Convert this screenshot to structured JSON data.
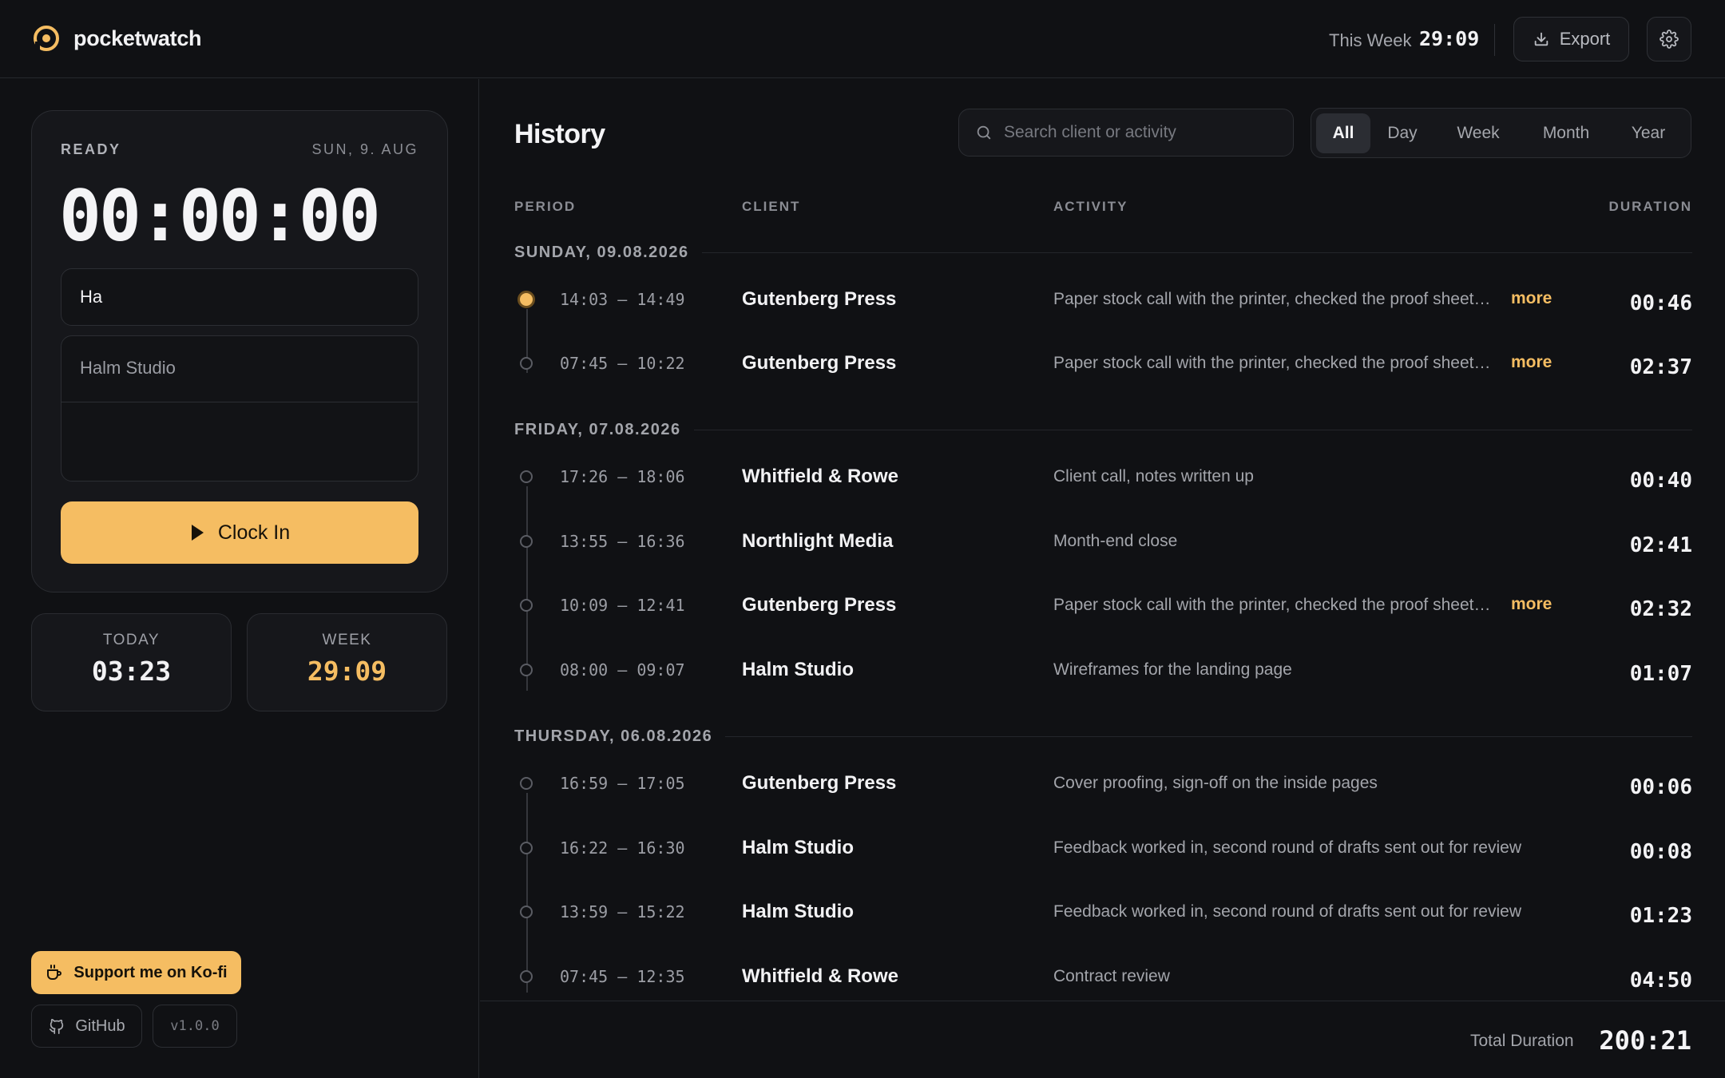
{
  "header": {
    "brand": "pocketwatch",
    "week_label": "This Week",
    "week_value": "29:09",
    "export_label": "Export"
  },
  "timer": {
    "status": "READY",
    "date": "SUN, 9. AUG",
    "clock": "00:00:00",
    "activity_value": "Ha",
    "client_value": "Halm Studio",
    "clock_in_label": "Clock In"
  },
  "stats": {
    "today_label": "TODAY",
    "today_value": "03:23",
    "week_label": "WEEK",
    "week_value": "29:09"
  },
  "links": {
    "kofi_label": "Support me on Ko-fi",
    "github_label": "GitHub",
    "version": "v1.0.0"
  },
  "history": {
    "title": "History",
    "search_placeholder": "Search client or activity",
    "tabs": [
      "All",
      "Day",
      "Week",
      "Month",
      "Year"
    ],
    "active_tab": "All",
    "columns": {
      "period": "PERIOD",
      "client": "CLIENT",
      "activity": "ACTIVITY",
      "duration": "DURATION"
    },
    "more_label": "more",
    "days": [
      {
        "label": "SUNDAY, 09.08.2026",
        "entries": [
          {
            "period": "14:03 – 14:49",
            "client": "Gutenberg Press",
            "activity": "Paper stock call with the printer, checked the proof sheet…",
            "more": true,
            "duration": "00:46",
            "active": true
          },
          {
            "period": "07:45 – 10:22",
            "client": "Gutenberg Press",
            "activity": "Paper stock call with the printer, checked the proof sheet…",
            "more": true,
            "duration": "02:37",
            "active": false
          }
        ]
      },
      {
        "label": "FRIDAY, 07.08.2026",
        "entries": [
          {
            "period": "17:26 – 18:06",
            "client": "Whitfield & Rowe",
            "activity": "Client call, notes written up",
            "more": false,
            "duration": "00:40",
            "active": false
          },
          {
            "period": "13:55 – 16:36",
            "client": "Northlight Media",
            "activity": "Month-end close",
            "more": false,
            "duration": "02:41",
            "active": false
          },
          {
            "period": "10:09 – 12:41",
            "client": "Gutenberg Press",
            "activity": "Paper stock call with the printer, checked the proof sheet…",
            "more": true,
            "duration": "02:32",
            "active": false
          },
          {
            "period": "08:00 – 09:07",
            "client": "Halm Studio",
            "activity": "Wireframes for the landing page",
            "more": false,
            "duration": "01:07",
            "active": false
          }
        ]
      },
      {
        "label": "THURSDAY, 06.08.2026",
        "entries": [
          {
            "period": "16:59 – 17:05",
            "client": "Gutenberg Press",
            "activity": "Cover proofing, sign-off on the inside pages",
            "more": false,
            "duration": "00:06",
            "active": false
          },
          {
            "period": "16:22 – 16:30",
            "client": "Halm Studio",
            "activity": "Feedback worked in, second round of drafts sent out for review",
            "more": false,
            "duration": "00:08",
            "active": false
          },
          {
            "period": "13:59 – 15:22",
            "client": "Halm Studio",
            "activity": "Feedback worked in, second round of drafts sent out for review",
            "more": false,
            "duration": "01:23",
            "active": false
          },
          {
            "period": "07:45 – 12:35",
            "client": "Whitfield & Rowe",
            "activity": "Contract review",
            "more": false,
            "duration": "04:50",
            "active": false
          }
        ]
      }
    ],
    "total_label": "Total Duration",
    "total_value": "200:21"
  },
  "colors": {
    "accent": "#f5bd62",
    "background": "#101114",
    "surface": "#16171b",
    "border": "#2a2c31"
  },
  "icons": {
    "brand": "pocketwatch-logo-icon",
    "export": "download-icon",
    "settings": "gear-icon",
    "search": "search-icon",
    "clock_in": "play-icon",
    "kofi": "coffee-cup-icon",
    "github": "github-icon"
  }
}
